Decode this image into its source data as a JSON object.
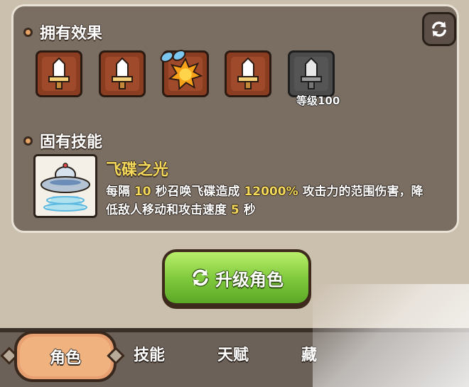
{
  "owned_effects": {
    "title": "拥有效果",
    "items": [
      {
        "icon": "sword-icon",
        "style": "brown"
      },
      {
        "icon": "sword-icon",
        "style": "brown"
      },
      {
        "icon": "burst-icon",
        "style": "brown"
      },
      {
        "icon": "sword-icon",
        "style": "brown"
      },
      {
        "icon": "sword-icon",
        "style": "gray",
        "caption": "等级100"
      }
    ]
  },
  "innate_skill": {
    "title": "固有技能",
    "name": "飞碟之光",
    "desc": {
      "p1": "每隔",
      "interval": "10",
      "p2": "秒召唤飞碟造成",
      "percent": "12000%",
      "p3": "攻击力的范围伤害，降低敌人移动和攻击速度",
      "duration": "5",
      "p4": "秒"
    }
  },
  "upgrade_button": {
    "label": "升级角色"
  },
  "tabs": [
    {
      "label": "角色",
      "active": true
    },
    {
      "label": "技能"
    },
    {
      "label": "天赋"
    },
    {
      "label": "藏"
    }
  ],
  "colors": {
    "panel": "#7a6d62",
    "accent_yellow": "#f5d95a",
    "button_green": "#7cc73a",
    "tab_active": "#f0b27e"
  }
}
